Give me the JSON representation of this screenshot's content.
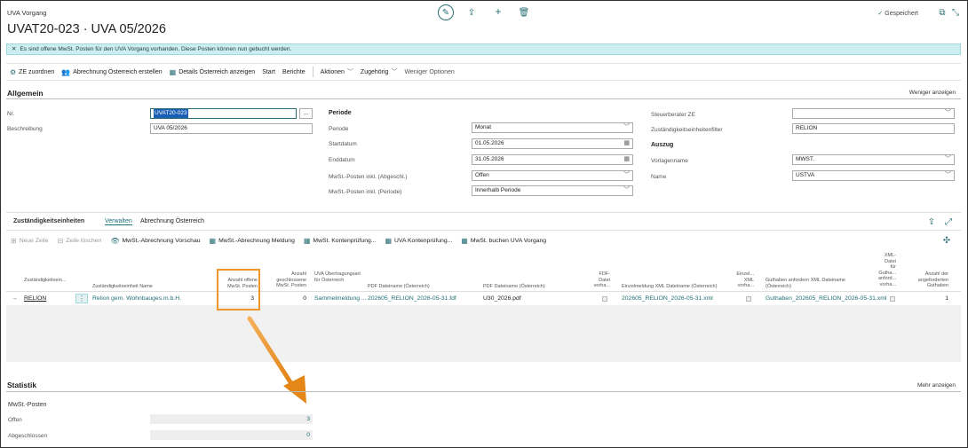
{
  "window": {
    "label": "UVA Vorgang",
    "title": "UVAT20-023 · UVA 05/2026",
    "saved_label": "Gespeichert"
  },
  "notification": {
    "text": "Es sind offene MwSt. Posten für den UVA Vorgang vorhanden. Diese Posten können nun gebucht werden."
  },
  "actions": [
    {
      "label": "ZE zuordnen",
      "icon": "gear-icon"
    },
    {
      "label": "Abrechnung Österreich erstellen",
      "icon": "people-icon"
    },
    {
      "label": "Details Österreich anzeigen",
      "icon": "table-icon"
    },
    {
      "label": "Start"
    },
    {
      "label": "Berichte"
    },
    {
      "label": "Aktionen"
    },
    {
      "label": "Zugehörig"
    },
    {
      "label": "Weniger Optionen"
    }
  ],
  "general": {
    "title": "Allgemein",
    "toggle": "Weniger anzeigen",
    "nr_label": "Nr.",
    "nr_value": "UVAT20-023",
    "desc_label": "Beschreibung",
    "desc_value": "UVA 05/2026",
    "period_heading": "Periode",
    "period_label": "Periode",
    "period_value": "Monat",
    "start_label": "Startdatum",
    "start_value": "01.05.2026",
    "end_label": "Enddatum",
    "end_value": "31.05.2026",
    "vat_closed_label": "MwSt.-Posten inkl. (Abgeschl.)",
    "vat_closed_value": "Offen",
    "vat_period_label": "MwSt.-Posten inkl. (Periode)",
    "vat_period_value": "Innerhalb Periode",
    "advisor_label": "Steuerberater ZE",
    "advisor_value": "",
    "unit_filter_label": "Zuständigkeitseinheitenfilter",
    "unit_filter_value": "RELION",
    "extract_heading": "Auszug",
    "template_label": "Vorlagenname",
    "template_value": "MWST.",
    "name_label": "Name",
    "name_value": "USTVA"
  },
  "units": {
    "tab_main": "Zuständigkeitseinheiten",
    "tab_manage": "Verwalten",
    "tab_austria": "Abrechnung Österreich",
    "actions": [
      {
        "label": "Neue Zeile"
      },
      {
        "label": "Zeile löschen"
      },
      {
        "label": "MwSt.-Abrechnung Vorschau"
      },
      {
        "label": "MwSt.-Abrechnung Meldung"
      },
      {
        "label": "MwSt. Kontenprüfung..."
      },
      {
        "label": "UVA Kontenprüfung..."
      },
      {
        "label": "MwSt. buchen UVA Vorgang"
      }
    ],
    "headers": {
      "unit": "Zuständigkeitsein...",
      "unit_name": "Zuständigkeitseinheit Name",
      "open_count": "Anzahl offene MwSt. Posten",
      "closed_count": "Anzahl geschlossene MwSt. Posten",
      "transfer": "UVA Übertragungsart für Österreich",
      "pdf_at": "PDF Dateiname (Österreich)",
      "pdf_at2": "PDF Dateiname (Österreich)",
      "pdf_exists": "FDF-Datei vorha...",
      "xml_single": "Einzelmeldung XML Dateiname (Österreich)",
      "xml_exists": "Einzel... XML vorha...",
      "credit_xml": "Guthaben anfordern XML Dateiname (Österreich)",
      "credit_exists": "XML-Datei für Gutha... anford... vorha...",
      "credit_count": "Anzahl der angeforderten Guthaben"
    },
    "row": {
      "unit": "RELION",
      "unit_name": "Relion gem. Wohnbauges.m.b.H.",
      "open_count": "3",
      "closed_count": "0",
      "transfer": "Sammelmeldung ...",
      "pdf_at": "202605_RELION_2026-05-31.fdf",
      "pdf_at2": "U30_2026.pdf",
      "xml_single": "202605_RELION_2026-05-31.xml",
      "credit_xml": "Guthaben_202605_RELION_2026-05-31.xml",
      "credit_count": "1"
    }
  },
  "statistics": {
    "title": "Statistik",
    "toggle": "Mehr anzeigen",
    "group": "MwSt.-Posten",
    "open_label": "Offen",
    "open_value": "3",
    "closed_label": "Abgeschlossen",
    "closed_value": "0"
  },
  "colors": {
    "accent": "#2a6f75",
    "highlight": "#f0952a",
    "notification": "#cdeef0"
  }
}
